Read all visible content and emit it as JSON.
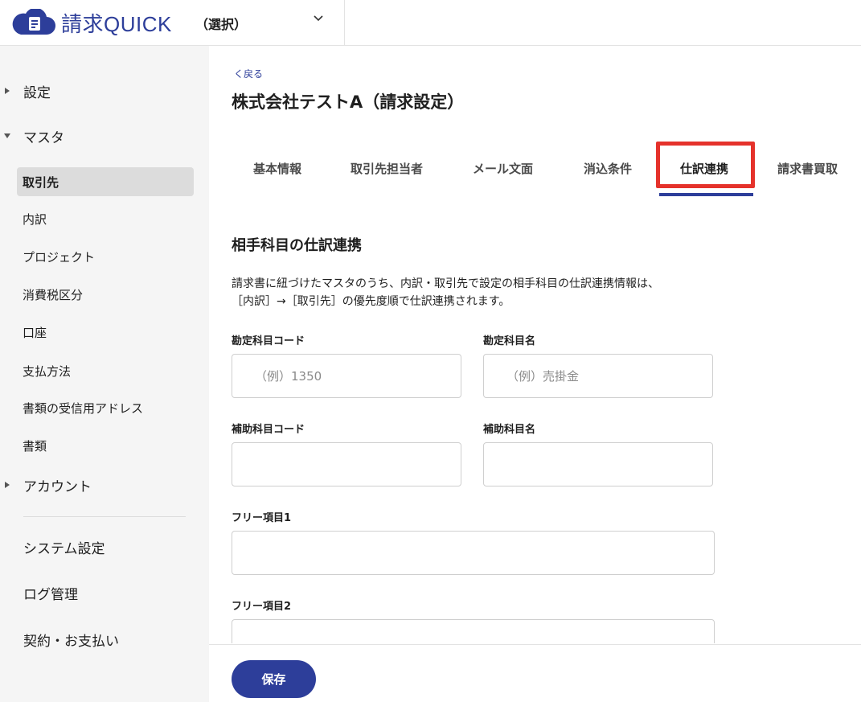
{
  "header": {
    "logo_text": "請求QUICK",
    "selector_label": "（選択）"
  },
  "sidebar": {
    "groups": [
      {
        "label": "設定",
        "expanded": false
      },
      {
        "label": "マスタ",
        "expanded": true
      },
      {
        "label": "アカウント",
        "expanded": false
      }
    ],
    "master_items": [
      {
        "label": "取引先",
        "active": true
      },
      {
        "label": "内訳"
      },
      {
        "label": "プロジェクト"
      },
      {
        "label": "消費税区分"
      },
      {
        "label": "口座"
      },
      {
        "label": "支払方法"
      },
      {
        "label": "書類の受信用アドレス"
      },
      {
        "label": "書類"
      }
    ],
    "system_items": [
      {
        "label": "システム設定"
      },
      {
        "label": "ログ管理"
      },
      {
        "label": "契約・お支払い"
      }
    ]
  },
  "main": {
    "back_label": "く戻る",
    "title": "株式会社テストA（請求設定）",
    "tabs": [
      {
        "label": "基本情報"
      },
      {
        "label": "取引先担当者"
      },
      {
        "label": "メール文面"
      },
      {
        "label": "消込条件"
      },
      {
        "label": "仕訳連携",
        "active": true
      },
      {
        "label": "請求書買取"
      }
    ],
    "section_title": "相手科目の仕訳連携",
    "description_line1": "請求書に紐づけたマスタのうち、内訳・取引先で設定の相手科目の仕訳連携情報は、",
    "description_line2": "［内訳］→［取引先］の優先度順で仕訳連携されます。",
    "fields": {
      "account_code": {
        "label": "勘定科目コード",
        "placeholder": "（例）1350",
        "value": ""
      },
      "account_name": {
        "label": "勘定科目名",
        "placeholder": "（例）売掛金",
        "value": ""
      },
      "sub_account_code": {
        "label": "補助科目コード",
        "placeholder": "",
        "value": ""
      },
      "sub_account_name": {
        "label": "補助科目名",
        "placeholder": "",
        "value": ""
      },
      "free1": {
        "label": "フリー項目1",
        "placeholder": "",
        "value": ""
      },
      "free2": {
        "label": "フリー項目2",
        "placeholder": "",
        "value": ""
      }
    }
  },
  "footer": {
    "save_label": "保存"
  },
  "colors": {
    "brand": "#2d3e9a",
    "highlight": "#e5322b",
    "sidebar_bg": "#f5f5f5",
    "active_item_bg": "#dcdcdc"
  }
}
